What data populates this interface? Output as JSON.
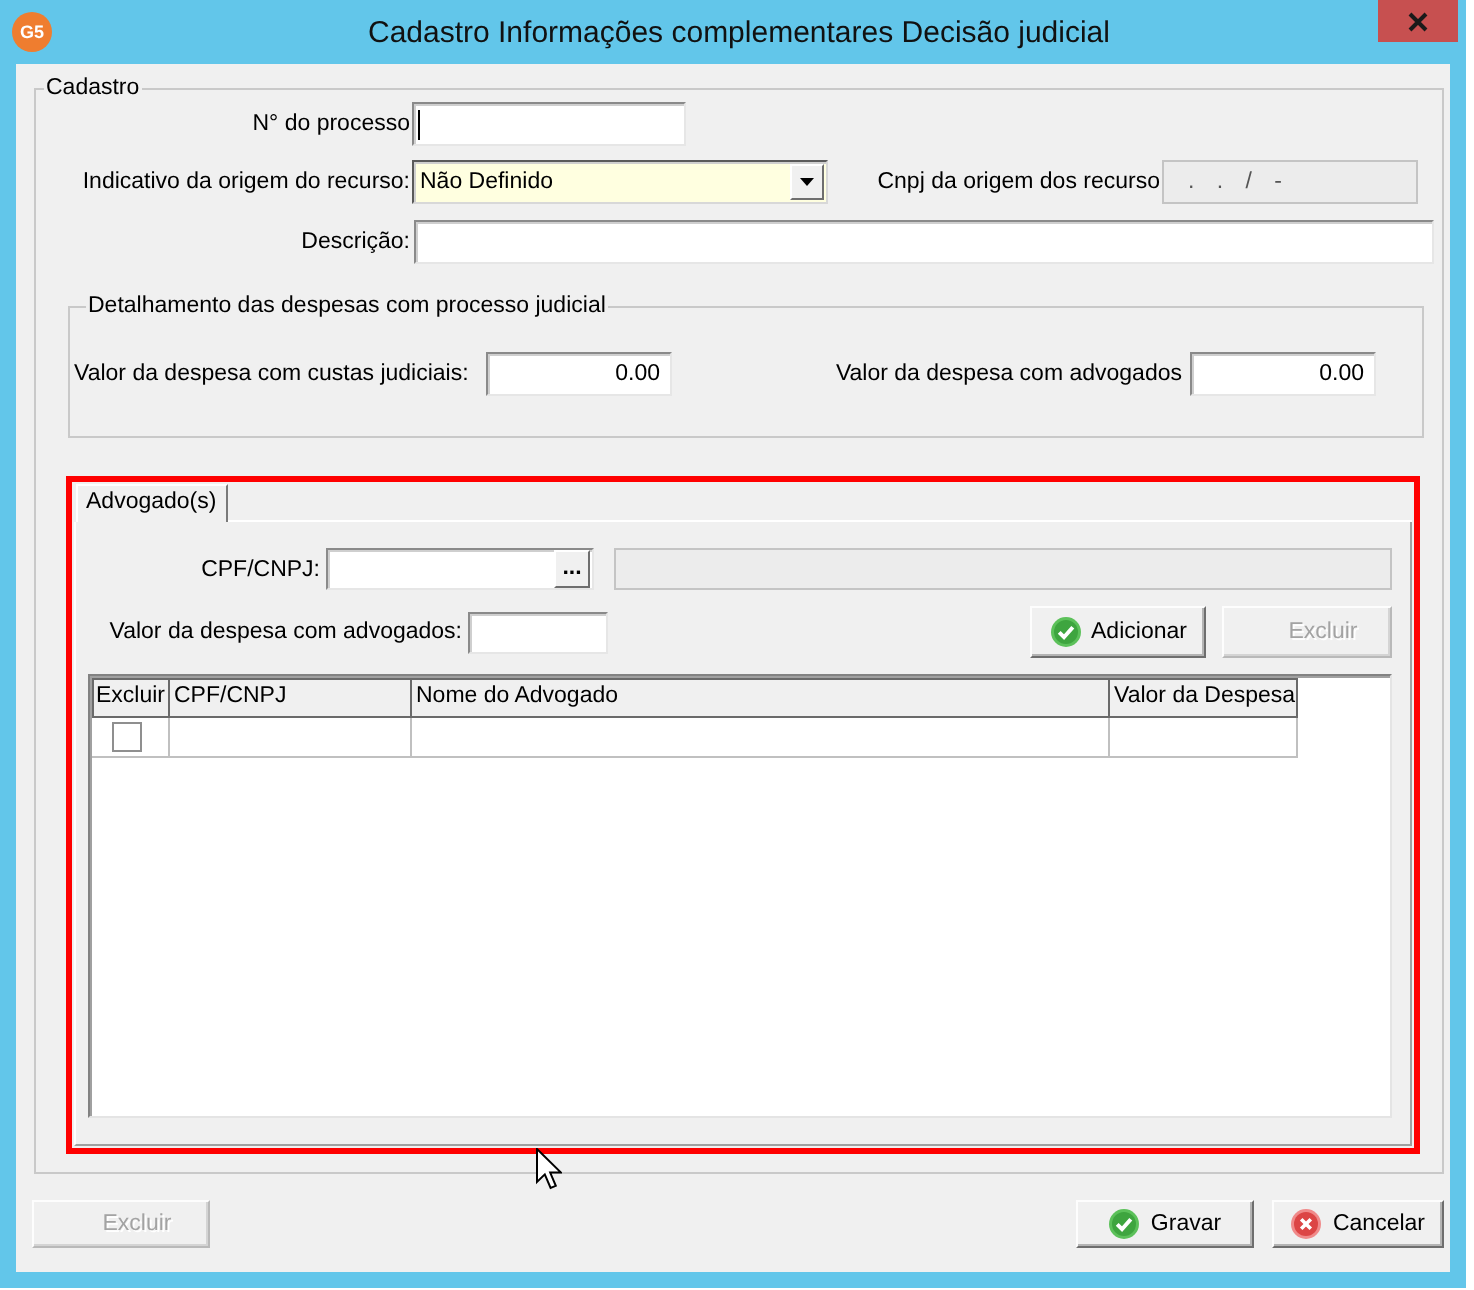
{
  "window": {
    "icon_text": "G5",
    "title": "Cadastro Informações complementares Decisão judicial"
  },
  "cadastro": {
    "legend": "Cadastro",
    "processo": {
      "label": "N° do processo",
      "focused": true
    },
    "origem": {
      "label": "Indicativo da origem do recurso:",
      "value": "Não Definido"
    },
    "cnpj_origem": {
      "label": "Cnpj da origem dos recurso",
      "value": ". . / -",
      "disabled": true
    },
    "descricao": {
      "label": "Descrição:"
    }
  },
  "despesas": {
    "legend": "Detalhamento das despesas com processo judicial",
    "fields": [
      {
        "label": "Valor da despesa com custas judiciais:",
        "value": "0.00"
      },
      {
        "label": "Valor da despesa com advogados",
        "value": "0.00"
      }
    ]
  },
  "advogados": {
    "highlighted": true,
    "tabs": [
      {
        "label": "Advogado(s)",
        "selected": true
      }
    ],
    "cpf": {
      "label": "CPF/CNPJ:",
      "lookup_button": "...",
      "name_field": {
        "disabled": true
      }
    },
    "valor": {
      "label": "Valor da despesa com advogados:"
    },
    "buttons": [
      {
        "label": "Adicionar",
        "kind": "confirm",
        "disabled": false
      },
      {
        "label": "Excluir",
        "kind": "plain",
        "disabled": true
      }
    ],
    "grid": {
      "columns": [
        "Excluir",
        "CPF/CNPJ",
        "Nome do Advogado",
        "Valor da Despesa"
      ],
      "rows": [
        {
          "checked": false
        }
      ]
    }
  },
  "footer": {
    "buttons": [
      {
        "label": "Excluir",
        "kind": "plain",
        "disabled": true
      },
      {
        "label": "Gravar",
        "kind": "confirm",
        "disabled": false
      },
      {
        "label": "Cancelar",
        "kind": "cancel",
        "disabled": false
      }
    ]
  }
}
